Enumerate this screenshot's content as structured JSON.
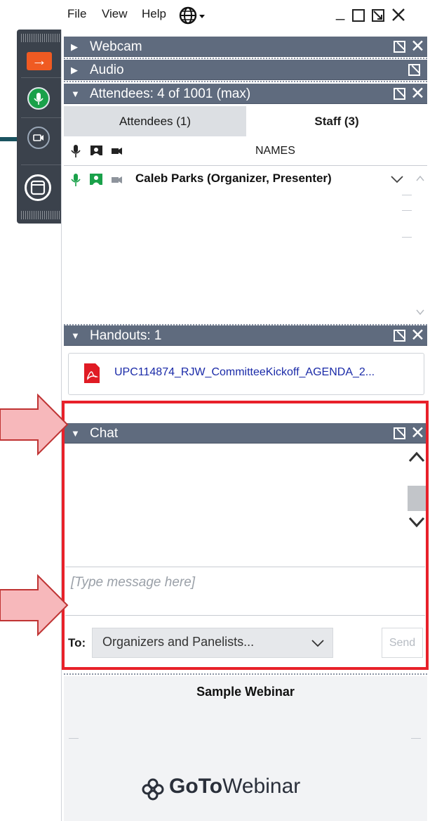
{
  "menu": {
    "file": "File",
    "view": "View",
    "help": "Help"
  },
  "window_controls": {
    "minimize": "_",
    "maximize": "□",
    "restore": "⧅",
    "close": "✕"
  },
  "sections": {
    "webcam": {
      "title": "Webcam",
      "expanded": false
    },
    "audio": {
      "title": "Audio",
      "expanded": false
    },
    "attendees": {
      "title": "Attendees: 4 of 1001 (max)",
      "expanded": true,
      "tabs": [
        {
          "label": "Attendees (1)",
          "active": false
        },
        {
          "label": "Staff (3)",
          "active": true
        }
      ],
      "column_header": "NAMES",
      "rows": [
        {
          "name": "Caleb Parks (Organizer, Presenter)"
        }
      ]
    },
    "handouts": {
      "title": "Handouts: 1",
      "expanded": true,
      "files": [
        {
          "name": "UPC114874_RJW_CommitteeKickoff_AGENDA_2..."
        }
      ]
    },
    "chat": {
      "title": "Chat",
      "expanded": true,
      "placeholder": "[Type message here]",
      "to_label": "To:",
      "recipient": "Organizers and Panelists...",
      "send_label": "Send"
    }
  },
  "webinar": {
    "title": "Sample Webinar",
    "brand_bold": "GoTo",
    "brand_light": "Webinar"
  },
  "colors": {
    "section_bar": "#5f6b7e",
    "highlight": "#e8212a",
    "arrow_fill": "#f7b8bb",
    "mic_active": "#1aa14a",
    "grabtab": "#3b424c",
    "grab_arrow": "#f05a22"
  }
}
